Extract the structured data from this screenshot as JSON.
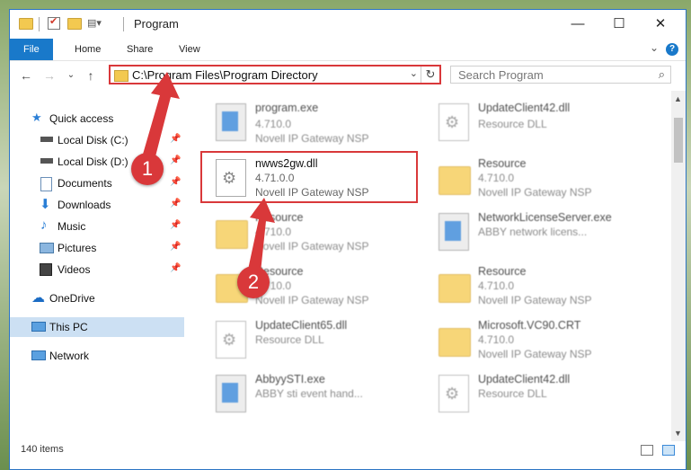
{
  "window": {
    "title": "Program",
    "minimize": "—",
    "maximize": "☐",
    "close": "✕"
  },
  "ribbon": {
    "tabs": [
      "File",
      "Home",
      "Share",
      "View"
    ],
    "help": "?",
    "collapse": "⌄"
  },
  "address": {
    "back": "←",
    "forward": "→",
    "recent": "⌄",
    "up": "↑",
    "path": "C:\\Program Files\\Program Directory",
    "dropdown": "⌄",
    "refresh": "↻"
  },
  "search": {
    "placeholder": "Search Program",
    "icon": "⌕"
  },
  "nav": {
    "items": [
      {
        "label": "Quick access",
        "icon": "star-icon"
      },
      {
        "label": "Local Disk (C:)",
        "icon": "drive-icon"
      },
      {
        "label": "Local Disk (D:)",
        "icon": "drive-icon"
      },
      {
        "label": "Documents",
        "icon": "documents-icon"
      },
      {
        "label": "Downloads",
        "icon": "downloads-icon"
      },
      {
        "label": "Music",
        "icon": "music-icon"
      },
      {
        "label": "Pictures",
        "icon": "pictures-icon"
      },
      {
        "label": "Videos",
        "icon": "videos-icon"
      },
      {
        "label": "OneDrive",
        "icon": "cloud-icon"
      },
      {
        "label": "This PC",
        "icon": "computer-icon"
      },
      {
        "label": "Network",
        "icon": "network-icon"
      }
    ],
    "pin": "📌"
  },
  "files": [
    {
      "name": "program.exe",
      "line2": "4.710.0",
      "line3": "Novell IP Gateway NSP",
      "type": "exe"
    },
    {
      "name": "UpdateClient42.dll",
      "line2": "Resource DLL",
      "line3": "",
      "type": "dll"
    },
    {
      "name": "nwws2gw.dll",
      "line2": "4.71.0.0",
      "line3": "Novell IP Gateway NSP",
      "type": "dll"
    },
    {
      "name": "Resource",
      "line2": "4.710.0",
      "line3": "Novell IP Gateway NSP",
      "type": "folder"
    },
    {
      "name": "Resource",
      "line2": "4.710.0",
      "line3": "Novell IP Gateway NSP",
      "type": "folder"
    },
    {
      "name": "NetworkLicenseServer.exe",
      "line2": "ABBY network licens...",
      "line3": "",
      "type": "exe"
    },
    {
      "name": "Resource",
      "line2": "4.710.0",
      "line3": "Novell IP Gateway NSP",
      "type": "folder"
    },
    {
      "name": "Resource",
      "line2": "4.710.0",
      "line3": "Novell IP Gateway NSP",
      "type": "folder"
    },
    {
      "name": "UpdateClient65.dll",
      "line2": "Resource DLL",
      "line3": "",
      "type": "dll"
    },
    {
      "name": "Microsoft.VC90.CRT",
      "line2": "4.710.0",
      "line3": "Novell IP Gateway NSP",
      "type": "folder"
    },
    {
      "name": "AbbyySTI.exe",
      "line2": "ABBY sti event hand...",
      "line3": "",
      "type": "exe"
    },
    {
      "name": "UpdateClient42.dll",
      "line2": "Resource DLL",
      "line3": "",
      "type": "dll"
    }
  ],
  "callouts": {
    "one": "1",
    "two": "2"
  },
  "status": {
    "count": "140 items"
  },
  "colors": {
    "accent": "#1979ca",
    "highlight": "#d9383a",
    "selected": "#cce0f3"
  }
}
